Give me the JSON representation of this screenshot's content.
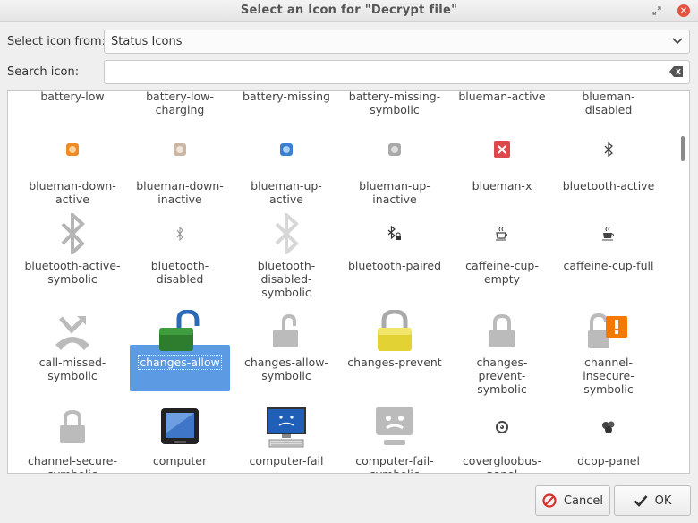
{
  "window": {
    "title": "Select an Icon for \"Decrypt file\""
  },
  "controls": {
    "icon_from_label": "Select icon from:",
    "icon_from_value": "Status Icons",
    "search_label": "Search icon:",
    "search_value": ""
  },
  "icons": [
    {
      "label": "battery-low",
      "icon": "battery-low-icon"
    },
    {
      "label": "battery-low-\ncharging",
      "icon": "battery-low-charging-icon"
    },
    {
      "label": "battery-missing",
      "icon": "battery-missing-icon"
    },
    {
      "label": "battery-missing-\nsymbolic",
      "icon": "battery-missing-symbolic-icon"
    },
    {
      "label": "blueman-active",
      "icon": "blueman-active-icon"
    },
    {
      "label": "blueman-\ndisabled",
      "icon": "blueman-disabled-icon"
    },
    {
      "label": "blueman-down-\nactive",
      "icon": "blueman-down-active-icon"
    },
    {
      "label": "blueman-down-\ninactive",
      "icon": "blueman-down-inactive-icon"
    },
    {
      "label": "blueman-up-\nactive",
      "icon": "blueman-up-active-icon"
    },
    {
      "label": "blueman-up-\ninactive",
      "icon": "blueman-up-inactive-icon"
    },
    {
      "label": "blueman-x",
      "icon": "blueman-x-icon"
    },
    {
      "label": "bluetooth-active",
      "icon": "bluetooth-active-icon"
    },
    {
      "label": "bluetooth-active-\nsymbolic",
      "icon": "bluetooth-active-symbolic-icon"
    },
    {
      "label": "bluetooth-\ndisabled",
      "icon": "bluetooth-disabled-icon"
    },
    {
      "label": "bluetooth-\ndisabled-\nsymbolic",
      "icon": "bluetooth-disabled-symbolic-icon"
    },
    {
      "label": "bluetooth-paired",
      "icon": "bluetooth-paired-icon"
    },
    {
      "label": "caffeine-cup-\nempty",
      "icon": "caffeine-cup-empty-icon"
    },
    {
      "label": "caffeine-cup-full",
      "icon": "caffeine-cup-full-icon"
    },
    {
      "label": "call-missed-\nsymbolic",
      "icon": "call-missed-symbolic-icon"
    },
    {
      "label": "changes-allow",
      "icon": "changes-allow-icon",
      "selected": true
    },
    {
      "label": "changes-allow-\nsymbolic",
      "icon": "changes-allow-symbolic-icon"
    },
    {
      "label": "changes-prevent",
      "icon": "changes-prevent-icon"
    },
    {
      "label": "changes-prevent-\nsymbolic",
      "icon": "changes-prevent-symbolic-icon"
    },
    {
      "label": "channel-\ninsecure-\nsymbolic",
      "icon": "channel-insecure-symbolic-icon"
    },
    {
      "label": "channel-secure-\nsymbolic",
      "icon": "channel-secure-symbolic-icon"
    },
    {
      "label": "computer",
      "icon": "computer-icon"
    },
    {
      "label": "computer-fail",
      "icon": "computer-fail-icon"
    },
    {
      "label": "computer-fail-\nsymbolic",
      "icon": "computer-fail-symbolic-icon"
    },
    {
      "label": "covergloobus-\npanel",
      "icon": "covergloobus-panel-icon"
    },
    {
      "label": "dcpp-panel",
      "icon": "dcpp-panel-icon"
    }
  ],
  "buttons": {
    "cancel": "Cancel",
    "ok": "OK"
  },
  "colors": {
    "selection": "#5d9ae4",
    "accent_red": "#d9322c"
  }
}
